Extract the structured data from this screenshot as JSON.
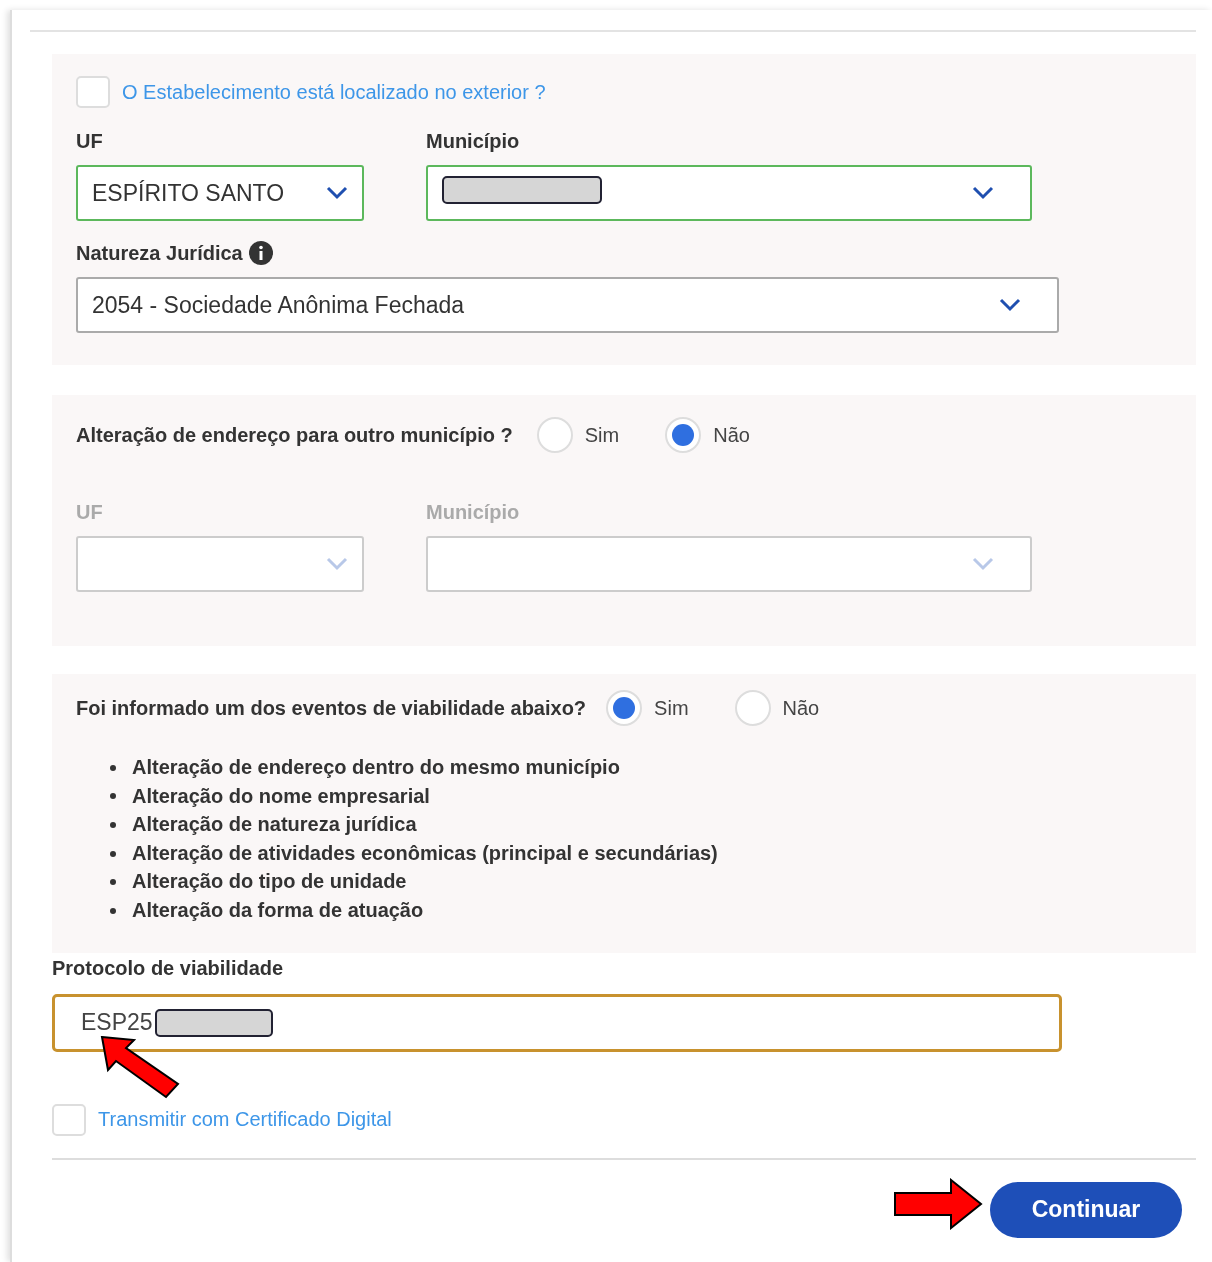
{
  "location": {
    "exterior_checkbox": {
      "label": "O Estabelecimento está localizado no exterior ?",
      "checked": false
    },
    "uf": {
      "label": "UF",
      "value": "ESPÍRITO SANTO"
    },
    "municipio": {
      "label": "Município"
    },
    "natureza_juridica": {
      "label": "Natureza Jurídica",
      "value": "2054 - Sociedade Anônima Fechada"
    }
  },
  "address_change": {
    "question": "Alteração de endereço para outro município ?",
    "options": [
      {
        "label": "Sim",
        "selected": false
      },
      {
        "label": "Não",
        "selected": true
      }
    ],
    "uf": {
      "label": "UF",
      "disabled": true
    },
    "municipio": {
      "label": "Município",
      "disabled": true
    }
  },
  "viability_events": {
    "question": "Foi informado um dos eventos de viabilidade abaixo?",
    "options": [
      {
        "label": "Sim",
        "selected": true
      },
      {
        "label": "Não",
        "selected": false
      }
    ],
    "events": [
      "Alteração de endereço dentro do mesmo município",
      "Alteração do nome empresarial",
      "Alteração de natureza jurídica",
      "Alteração de atividades econômicas (principal e secundárias)",
      "Alteração do tipo de unidade",
      "Alteração da forma de atuação"
    ]
  },
  "protocolo": {
    "label": "Protocolo de viabilidade",
    "value": "ESP25"
  },
  "certificado_checkbox": {
    "label": "Transmitir com Certificado Digital",
    "checked": false
  },
  "continue_button": "Continuar"
}
